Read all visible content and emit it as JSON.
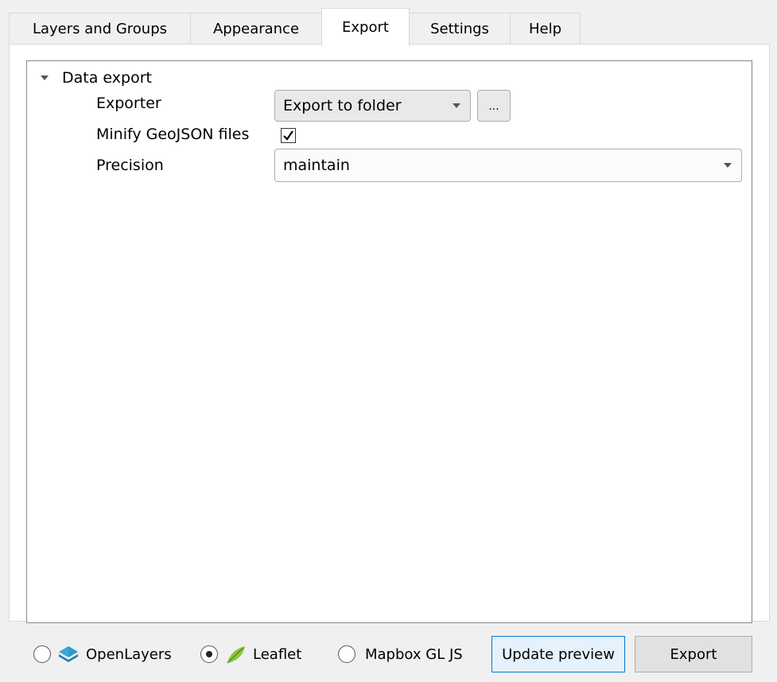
{
  "tabs": [
    {
      "label": "Layers and Groups",
      "active": false
    },
    {
      "label": "Appearance",
      "active": false
    },
    {
      "label": "Export",
      "active": true
    },
    {
      "label": "Settings",
      "active": false
    },
    {
      "label": "Help",
      "active": false
    }
  ],
  "export_panel": {
    "group_label": "Data export",
    "exporter": {
      "label": "Exporter",
      "value": "Export to folder",
      "browse_label": "..."
    },
    "minify": {
      "label": "Minify GeoJSON files",
      "checked": true
    },
    "precision": {
      "label": "Precision",
      "value": "maintain"
    }
  },
  "bottom_bar": {
    "renderers": [
      {
        "label": "OpenLayers",
        "icon": "openlayers-icon",
        "selected": false
      },
      {
        "label": "Leaflet",
        "icon": "leaflet-icon",
        "selected": true
      },
      {
        "label": "Mapbox GL JS",
        "icon": "",
        "selected": false
      }
    ],
    "update_preview_label": "Update preview",
    "export_label": "Export"
  },
  "colors": {
    "background": "#f0f0f0",
    "focus_border": "#0078d7",
    "openlayers_icon": "#2e9bc6",
    "leaflet_icon": "#8ec63f"
  }
}
